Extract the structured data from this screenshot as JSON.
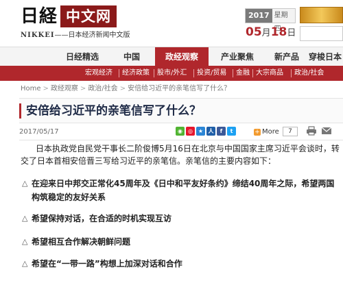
{
  "header": {
    "logo_jp": "日経",
    "logo_cn": "中文网",
    "logo_sub_brand": "NIKKEI",
    "logo_sub_text": "——日本经济新闻中文版",
    "year": "2017",
    "weekday": "星期四",
    "month": "05",
    "month_suffix": "月",
    "day": "18",
    "day_suffix": "日",
    "search_placeholder": ""
  },
  "main_nav": [
    {
      "label": "日经精选",
      "active": false
    },
    {
      "label": "中国",
      "active": false
    },
    {
      "label": "政经观察",
      "active": true
    },
    {
      "label": "产业聚焦",
      "active": false
    },
    {
      "label": "新产品",
      "active": false
    },
    {
      "label": "穿梭日本",
      "active": false
    }
  ],
  "sub_nav": [
    "宏观经济",
    "经济政策",
    "股市/外汇",
    "投资/贸易",
    "金融",
    "大宗商品",
    "政治/社会"
  ],
  "breadcrumb": [
    "Home",
    "政经观察",
    "政治/社会",
    "安倍给习近平的亲笔信写了什么？"
  ],
  "article": {
    "title": "安倍给习近平的亲笔信写了什么？",
    "date": "2017/05/17",
    "more_label": "More",
    "share_count": "7",
    "intro": "日本执政党自民党干事长二阶俊博5月16日在北京与中国国家主席习近平会谈时，转交了日本首相安倍晋三写给习近平的亲笔信。亲笔信的主要内容如下：",
    "points": [
      "在迎来日中邦交正常化45周年及《日中和平友好条约》缔结40周年之际，希望两国构筑稳定的友好关系",
      "希望保持对话，在合适的时机实现互访",
      "希望相互合作解决朝鲜问题",
      "希望在“一带一路”构想上加深对话和合作"
    ]
  },
  "colors": {
    "brand_red": "#b0272c",
    "title_navy": "#1e2a46"
  },
  "icons": {
    "share": [
      "wechat-icon",
      "weibo-icon",
      "qzone-icon",
      "renren-icon",
      "facebook-icon",
      "twitter-icon"
    ],
    "tools": [
      "print-icon",
      "mail-icon"
    ]
  }
}
